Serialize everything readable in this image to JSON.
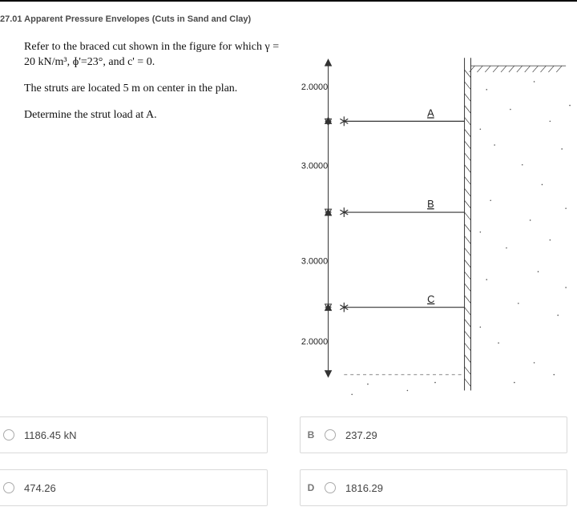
{
  "section_title": "27.01 Apparent Pressure Envelopes (Cuts in Sand and Clay)",
  "problem": {
    "p1": "Refer to the braced cut shown in the figure for which γ = 20 kN/m³, ɸ'=23°, and c' = 0.",
    "p2": "The struts are located 5 m on center in the plan.",
    "p3": "Determine the strut load at A."
  },
  "figure": {
    "dims": {
      "d1": "2.0000",
      "d2": "3.0000",
      "d3": "3.0000",
      "d4": "2.0000"
    },
    "struts": {
      "a": "A",
      "b": "B",
      "c": "C"
    }
  },
  "answers": {
    "a": {
      "tag": "",
      "value": "1186.45 kN"
    },
    "b": {
      "tag": "B",
      "value": "237.29"
    },
    "c": {
      "tag": "",
      "value": "474.26"
    },
    "d": {
      "tag": "D",
      "value": "1816.29"
    }
  }
}
